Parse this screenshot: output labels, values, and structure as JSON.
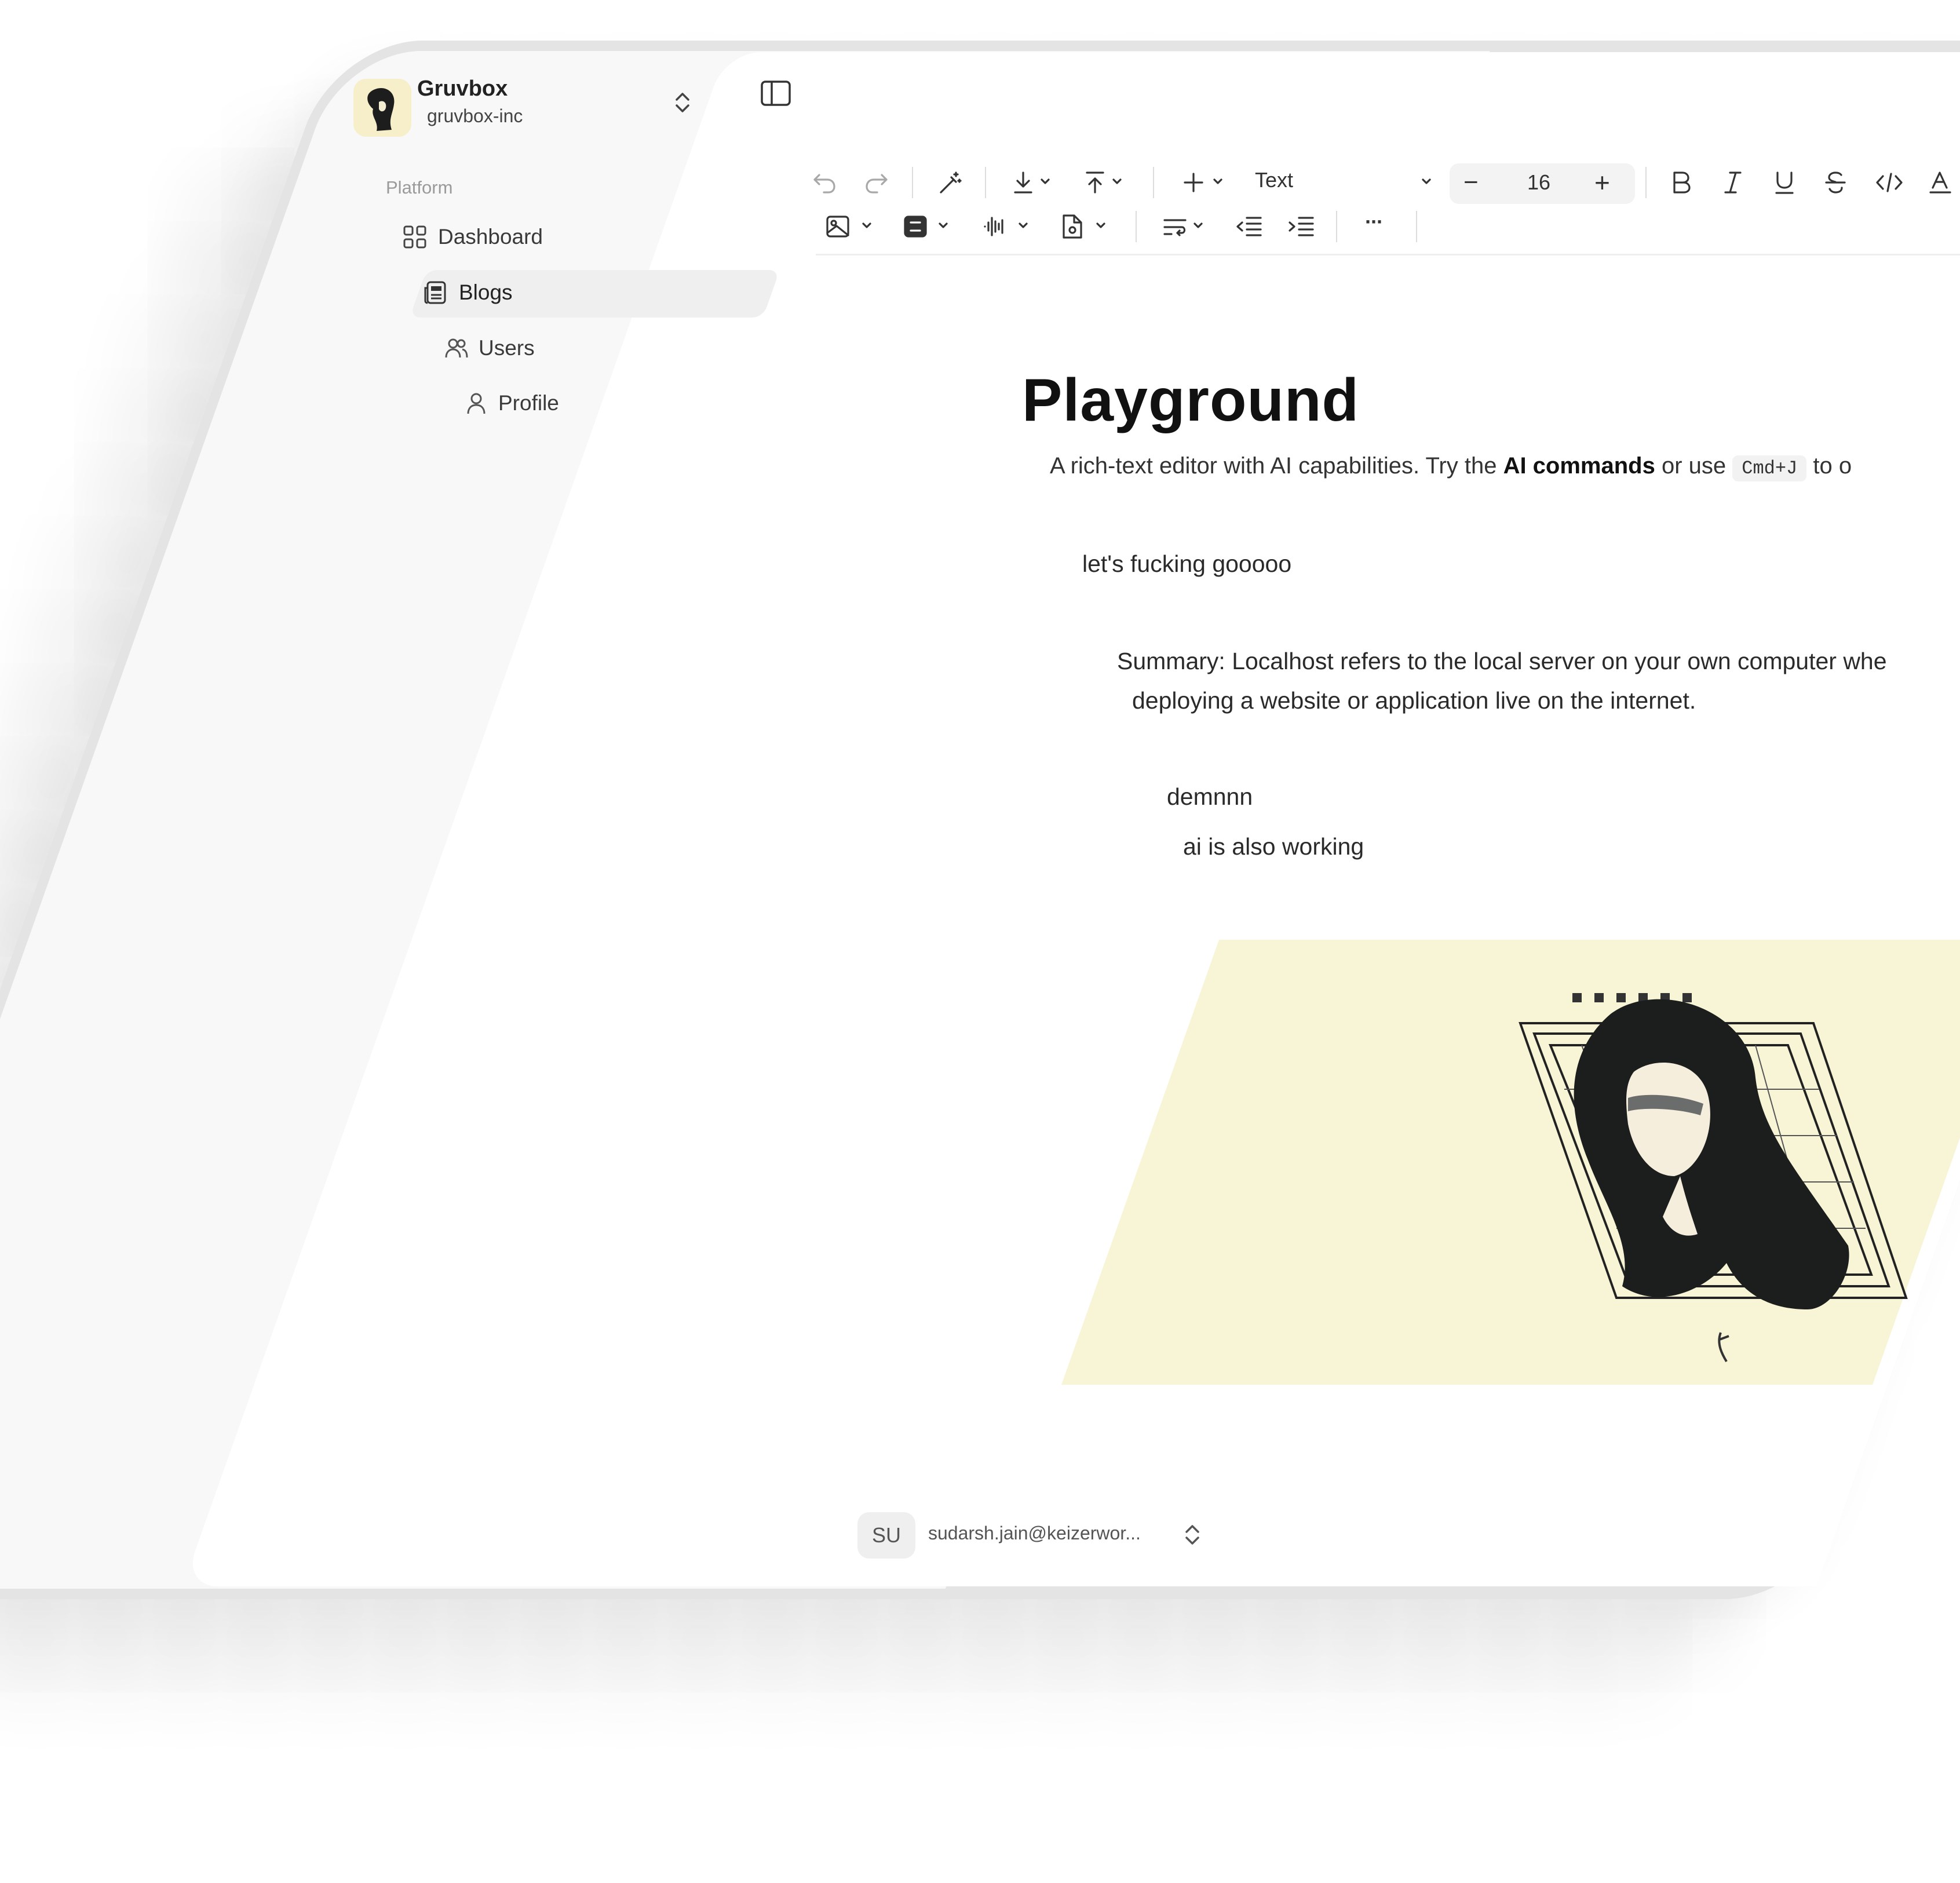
{
  "team": {
    "name": "Gruvbox",
    "slug": "gruvbox-inc"
  },
  "sidebar": {
    "group_label": "Platform",
    "items": [
      {
        "label": "Dashboard",
        "icon": "dashboard-icon",
        "active": false
      },
      {
        "label": "Blogs",
        "icon": "newspaper-icon",
        "active": true
      },
      {
        "label": "Users",
        "icon": "users-icon",
        "active": false
      },
      {
        "label": "Profile",
        "icon": "user-icon",
        "active": false
      }
    ]
  },
  "user": {
    "initials": "SU",
    "email": "sudarsh.jain@keizerwor..."
  },
  "toolbar": {
    "block_type": "Text",
    "font_size": "16",
    "minus": "−",
    "plus": "+",
    "more": "···"
  },
  "document": {
    "title": "Playground",
    "lead_prefix": "A rich-text editor with AI capabilities. Try the ",
    "lead_bold": "AI commands",
    "lead_mid": " or use ",
    "lead_kbd": "Cmd+J",
    "lead_suffix": " to o",
    "para1": "let's fucking gooooo",
    "summary_line1": "Summary: Localhost refers to the local server on your own computer whe",
    "summary_line2": "deploying a website or application live on the internet.",
    "para3": "demnnn",
    "para4": "ai is also working"
  },
  "colors": {
    "accent_bg": "#f8f5d6",
    "active_item_bg": "#efefef",
    "frame": "#e4e4e4"
  }
}
